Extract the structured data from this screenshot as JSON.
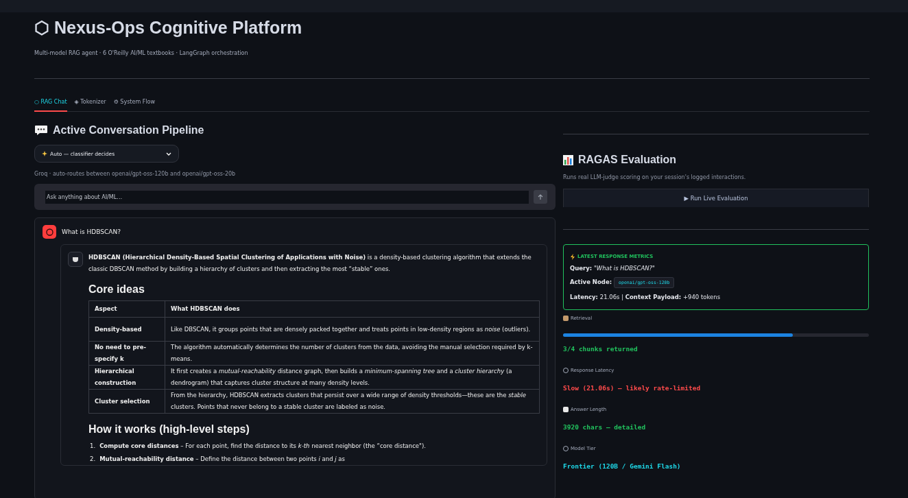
{
  "header": {
    "title": "⬡ Nexus-Ops Cognitive Platform",
    "subtitle": "Multi-model RAG agent · 6 O'Reilly AI/ML textbooks · LangGraph orchestration"
  },
  "tabs": [
    {
      "label": "○ RAG Chat",
      "selected": true
    },
    {
      "label": "◈ Tokenizer",
      "selected": false
    },
    {
      "label": "⚙ System Flow",
      "selected": false
    }
  ],
  "chat": {
    "heading": "Active Conversation Pipeline",
    "model_select": {
      "value": "Auto — classifier decides"
    },
    "model_caption": "Groq · auto-routes between openai/gpt-oss-120b and openai/gpt-oss-20b",
    "input": {
      "placeholder": "Ask anything about AI/ML…"
    },
    "question": {
      "text": "What is HDBSCAN?"
    },
    "answer": {
      "intro": "**HDBSCAN (Hierarchical Density-Based Spatial Clustering of Applications with Noise)** is a density-based clustering algorithm that extends the classic DBSCAN method by building a hierarchy of clusters and then extracting the most “stable” ones.",
      "section_1": "Core ideas",
      "table": {
        "columns": [
          "Aspect",
          "What HDBSCAN does"
        ],
        "rows": [
          [
            "Density-based",
            "Like DBSCAN, it groups points that are densely packed together and treats points in low-density regions as *noise* (outliers)."
          ],
          [
            "No need to pre-specify k",
            "The algorithm automatically determines the number of clusters from the data, avoiding the manual selection required by k-means."
          ],
          [
            "Hierarchical construction",
            "It first creates a *mutual-reachability* distance graph, then builds a *minimum-spanning tree* and a *cluster hierarchy* (a dendrogram) that captures cluster structure at many density levels."
          ],
          [
            "Cluster selection",
            "From the hierarchy, HDBSCAN extracts clusters that persist over a wide range of density thresholds—these are the *stable* clusters. Points that never belong to a stable cluster are labeled as noise."
          ]
        ]
      },
      "section_2": "How it works (high-level steps)",
      "steps": [
        {
          "number": "1.",
          "text": "**Compute core distances** – For each point, find the distance to its *k-th* nearest neighbor (the “core distance\")."
        },
        {
          "number": "2.",
          "text": "**Mutual-reachability distance** – Define the distance between two points *i* and *j* as"
        }
      ]
    }
  },
  "evaluation": {
    "heading": "RAGAS Evaluation",
    "caption": "Runs real LLM-judge scoring on your session's logged interactions.",
    "run_button": "▶ Run Live Evaluation"
  },
  "latest_metrics": {
    "title": "LATEST RESPONSE METRICS",
    "query_label": "Query:",
    "query": "\"What is HDBSCAN?\"",
    "node_label": "Active Node:",
    "node": "openai/gpt-oss-120b",
    "latency_label": "Latency:",
    "latency": "21.06s",
    "separator": "|",
    "payload_label": "Context Payload:",
    "payload": "+940 tokens"
  },
  "metrics": [
    {
      "kind": "bar",
      "label": "Retrieval",
      "level": 0.75,
      "value": "3/4 chunks returned",
      "color": "#21c35e"
    },
    {
      "kind": "text",
      "label": "Response Latency",
      "value": "Slow (21.06s) — likely rate-limited",
      "color": "#ff4b4b"
    },
    {
      "kind": "text",
      "label": "Answer Length",
      "value": "3920 chars — detailed",
      "color": "#21c35e"
    },
    {
      "kind": "text",
      "label": "Model Tier",
      "value": "Frontier (120B / Gemini Flash)",
      "color": "#1ed8e8"
    }
  ]
}
